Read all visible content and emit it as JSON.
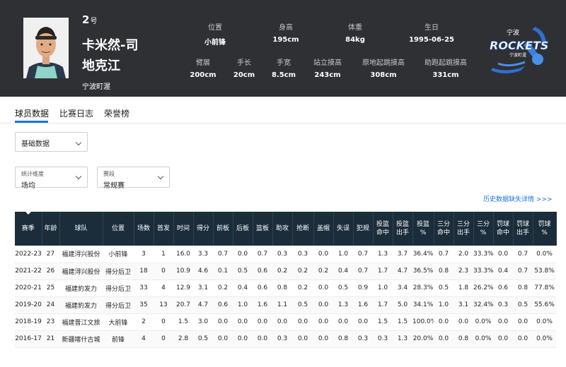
{
  "player": {
    "number": "2",
    "number_suffix": "号",
    "name_line1": "卡米然-司",
    "name_line2": "地克江",
    "team": "宁波町渥"
  },
  "stats_row1": [
    {
      "label": "位置",
      "value": "小前锋"
    },
    {
      "label": "身高",
      "value": "195cm"
    },
    {
      "label": "体重",
      "value": "84kg"
    },
    {
      "label": "生日",
      "value": "1995-06-25"
    }
  ],
  "stats_row2": [
    {
      "label": "臂展",
      "value": "200cm"
    },
    {
      "label": "手长",
      "value": "20cm"
    },
    {
      "label": "手宽",
      "value": "8.5cm"
    },
    {
      "label": "站立摸高",
      "value": "243cm"
    },
    {
      "label": "原地起跳摸高",
      "value": "308cm"
    },
    {
      "label": "助跑起跳摸高",
      "value": "331cm"
    }
  ],
  "logo": {
    "top_text": "宁波",
    "main_text": "ROCKETS",
    "sub_text": "宁波町渥"
  },
  "tabs": [
    "球员数据",
    "比赛日志",
    "荣誉榜"
  ],
  "select_basic": "基础数据",
  "filter1": {
    "label": "统计维度",
    "value": "场均"
  },
  "filter2": {
    "label": "赛段",
    "value": "常规赛"
  },
  "history_link": "历史数据缺失详情 >>>",
  "table": {
    "headers": [
      "赛季",
      "年龄",
      "球队",
      "位置",
      "场数",
      "首发",
      "时间",
      "得分",
      "前板",
      "后板",
      "篮板",
      "助攻",
      "抢断",
      "盖帽",
      "失误",
      "犯规",
      "投篮命中",
      "投篮出手",
      "投篮%",
      "三分命中",
      "三分出手",
      "三分%",
      "罚球命中",
      "罚球出手",
      "罚球%"
    ],
    "rows": [
      [
        "2022-23",
        "27",
        "福建浔兴股份",
        "小前锋",
        "3",
        "1",
        "16.0",
        "3.3",
        "0.7",
        "0.0",
        "0.7",
        "0.3",
        "0.3",
        "0.0",
        "1.0",
        "0.7",
        "1.3",
        "3.7",
        "36.4%",
        "0.7",
        "2.0",
        "33.3%",
        "0.0",
        "0.7",
        "0.0%"
      ],
      [
        "2021-22",
        "26",
        "福建浔兴股份",
        "得分后卫",
        "18",
        "0",
        "10.9",
        "4.6",
        "0.1",
        "0.5",
        "0.6",
        "0.2",
        "0.2",
        "0.2",
        "0.4",
        "0.7",
        "1.7",
        "4.7",
        "36.5%",
        "0.8",
        "2.3",
        "33.3%",
        "0.4",
        "0.7",
        "53.8%"
      ],
      [
        "2020-21",
        "25",
        "福建豹发力",
        "得分后卫",
        "33",
        "4",
        "12.9",
        "3.1",
        "0.2",
        "0.4",
        "0.6",
        "0.8",
        "0.2",
        "0.0",
        "0.5",
        "0.9",
        "1.0",
        "3.4",
        "28.3%",
        "0.5",
        "1.8",
        "26.2%",
        "0.6",
        "0.8",
        "77.8%"
      ],
      [
        "2019-20",
        "24",
        "福建豹发力",
        "得分后卫",
        "35",
        "13",
        "20.7",
        "4.7",
        "0.6",
        "1.0",
        "1.6",
        "1.1",
        "0.5",
        "0.0",
        "1.3",
        "1.6",
        "1.7",
        "5.0",
        "34.1%",
        "1.0",
        "3.1",
        "32.4%",
        "0.3",
        "0.5",
        "55.6%"
      ],
      [
        "2018-19",
        "23",
        "福建晋江文旅",
        "大前锋",
        "2",
        "0",
        "1.5",
        "3.0",
        "0.0",
        "0.0",
        "0.0",
        "0.0",
        "0.0",
        "0.0",
        "0.0",
        "0.0",
        "1.5",
        "1.5",
        "100.0%",
        "0.0",
        "0.0",
        "0.0%",
        "0.0",
        "0.0",
        "0.0%"
      ],
      [
        "2016-17",
        "21",
        "新疆喀什古城",
        "前锋",
        "4",
        "0",
        "2.8",
        "0.5",
        "0.0",
        "0.0",
        "0.0",
        "0.3",
        "0.0",
        "0.0",
        "0.8",
        "0.3",
        "0.3",
        "1.3",
        "20.0%",
        "0.0",
        "0.8",
        "0.0%",
        "0.0",
        "0.0",
        "0.0%"
      ]
    ]
  }
}
